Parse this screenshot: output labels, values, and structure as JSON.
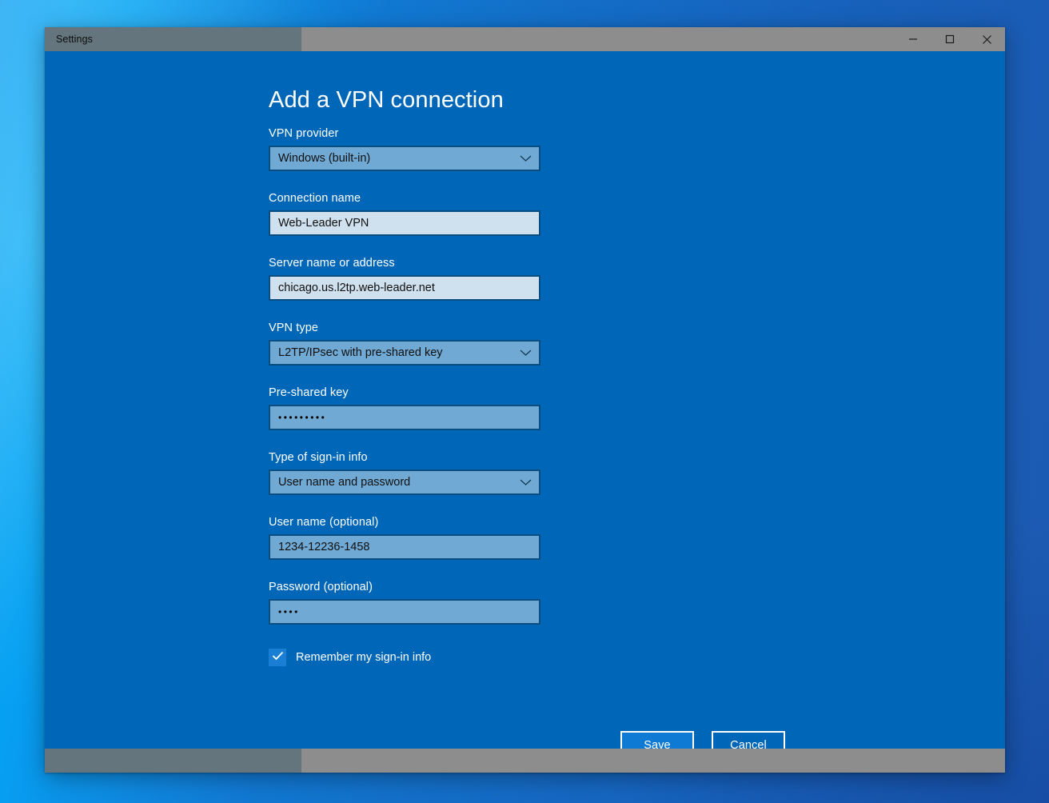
{
  "window": {
    "title": "Settings",
    "controls": {
      "minimize": "minimize",
      "maximize": "maximize",
      "close": "close"
    }
  },
  "page": {
    "title": "Add a VPN connection"
  },
  "form": {
    "vpn_provider": {
      "label": "VPN provider",
      "value": "Windows (built-in)",
      "type": "select"
    },
    "connection_name": {
      "label": "Connection name",
      "value": "Web-Leader VPN",
      "type": "text"
    },
    "server_name": {
      "label": "Server name or address",
      "value": "chicago.us.l2tp.web-leader.net",
      "type": "text"
    },
    "vpn_type": {
      "label": "VPN type",
      "value": "L2TP/IPsec with pre-shared key",
      "type": "select"
    },
    "pre_shared_key": {
      "label": "Pre-shared key",
      "value": "•••••••••",
      "type": "password"
    },
    "signin_type": {
      "label": "Type of sign-in info",
      "value": "User name and password",
      "type": "select"
    },
    "user_name": {
      "label": "User name (optional)",
      "value": "1234-12236-1458",
      "type": "text"
    },
    "password": {
      "label": "Password (optional)",
      "value": "••••",
      "type": "password"
    },
    "remember": {
      "label": "Remember my sign-in info",
      "checked": "checked"
    }
  },
  "actions": {
    "save": "Save",
    "cancel": "Cancel"
  },
  "colors": {
    "accent": "#0067b8",
    "button_primary": "#0f7ad4",
    "select_fill": "#6fa9d4",
    "input_fill": "#cfe0ee",
    "checkbox_fill": "#1a7fd4",
    "titlebar": "#8d8d8d",
    "titlebar_active_segment": "#65757d"
  }
}
